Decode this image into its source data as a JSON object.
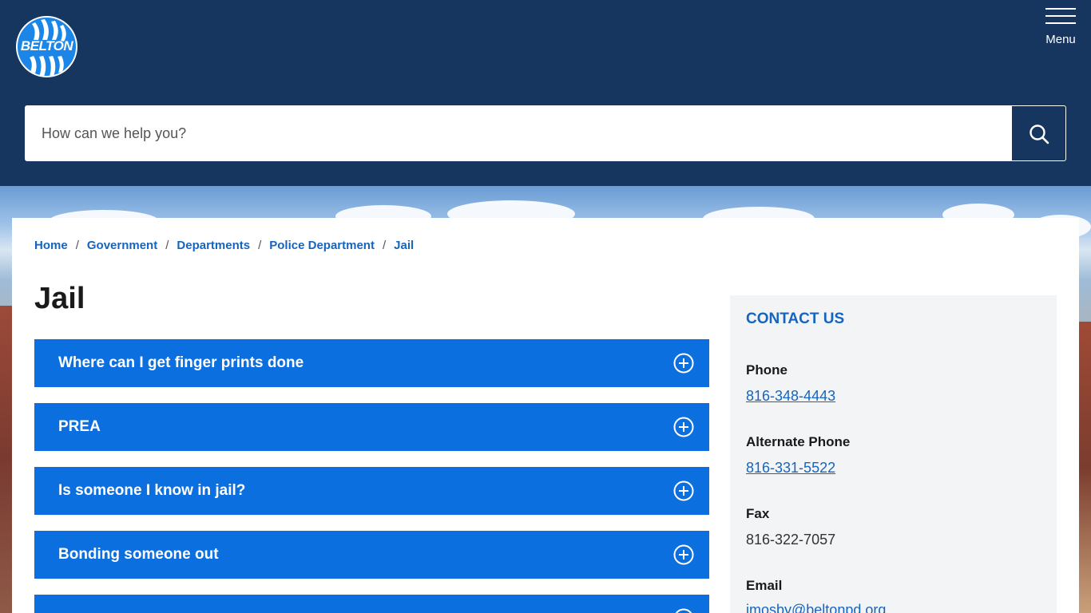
{
  "header": {
    "logo_text": "BELTON",
    "menu_label": "Menu"
  },
  "search": {
    "placeholder": "How can we help you?"
  },
  "breadcrumb": [
    "Home",
    "Government",
    "Departments",
    "Police Department",
    "Jail"
  ],
  "page": {
    "title": "Jail"
  },
  "accordion": [
    {
      "label": "Where can I get finger prints done"
    },
    {
      "label": "PREA"
    },
    {
      "label": "Is someone I know in jail?"
    },
    {
      "label": "Bonding someone out"
    },
    {
      "label": ""
    }
  ],
  "contact": {
    "heading": "CONTACT US",
    "phone_label": "Phone",
    "phone": "816-348-4443",
    "alt_phone_label": "Alternate Phone",
    "alt_phone": "816-331-5522",
    "fax_label": "Fax",
    "fax": "816-322-7057",
    "email_label": "Email",
    "email": "jmosby@beltonpd.org"
  },
  "colors": {
    "header_bg": "#17365f",
    "accordion_bg": "#0b6fe0",
    "link": "#1565c0",
    "sidebar_bg": "#f3f4f6"
  },
  "icons": [
    "search-icon",
    "menu-icon",
    "plus-circle-icon"
  ]
}
